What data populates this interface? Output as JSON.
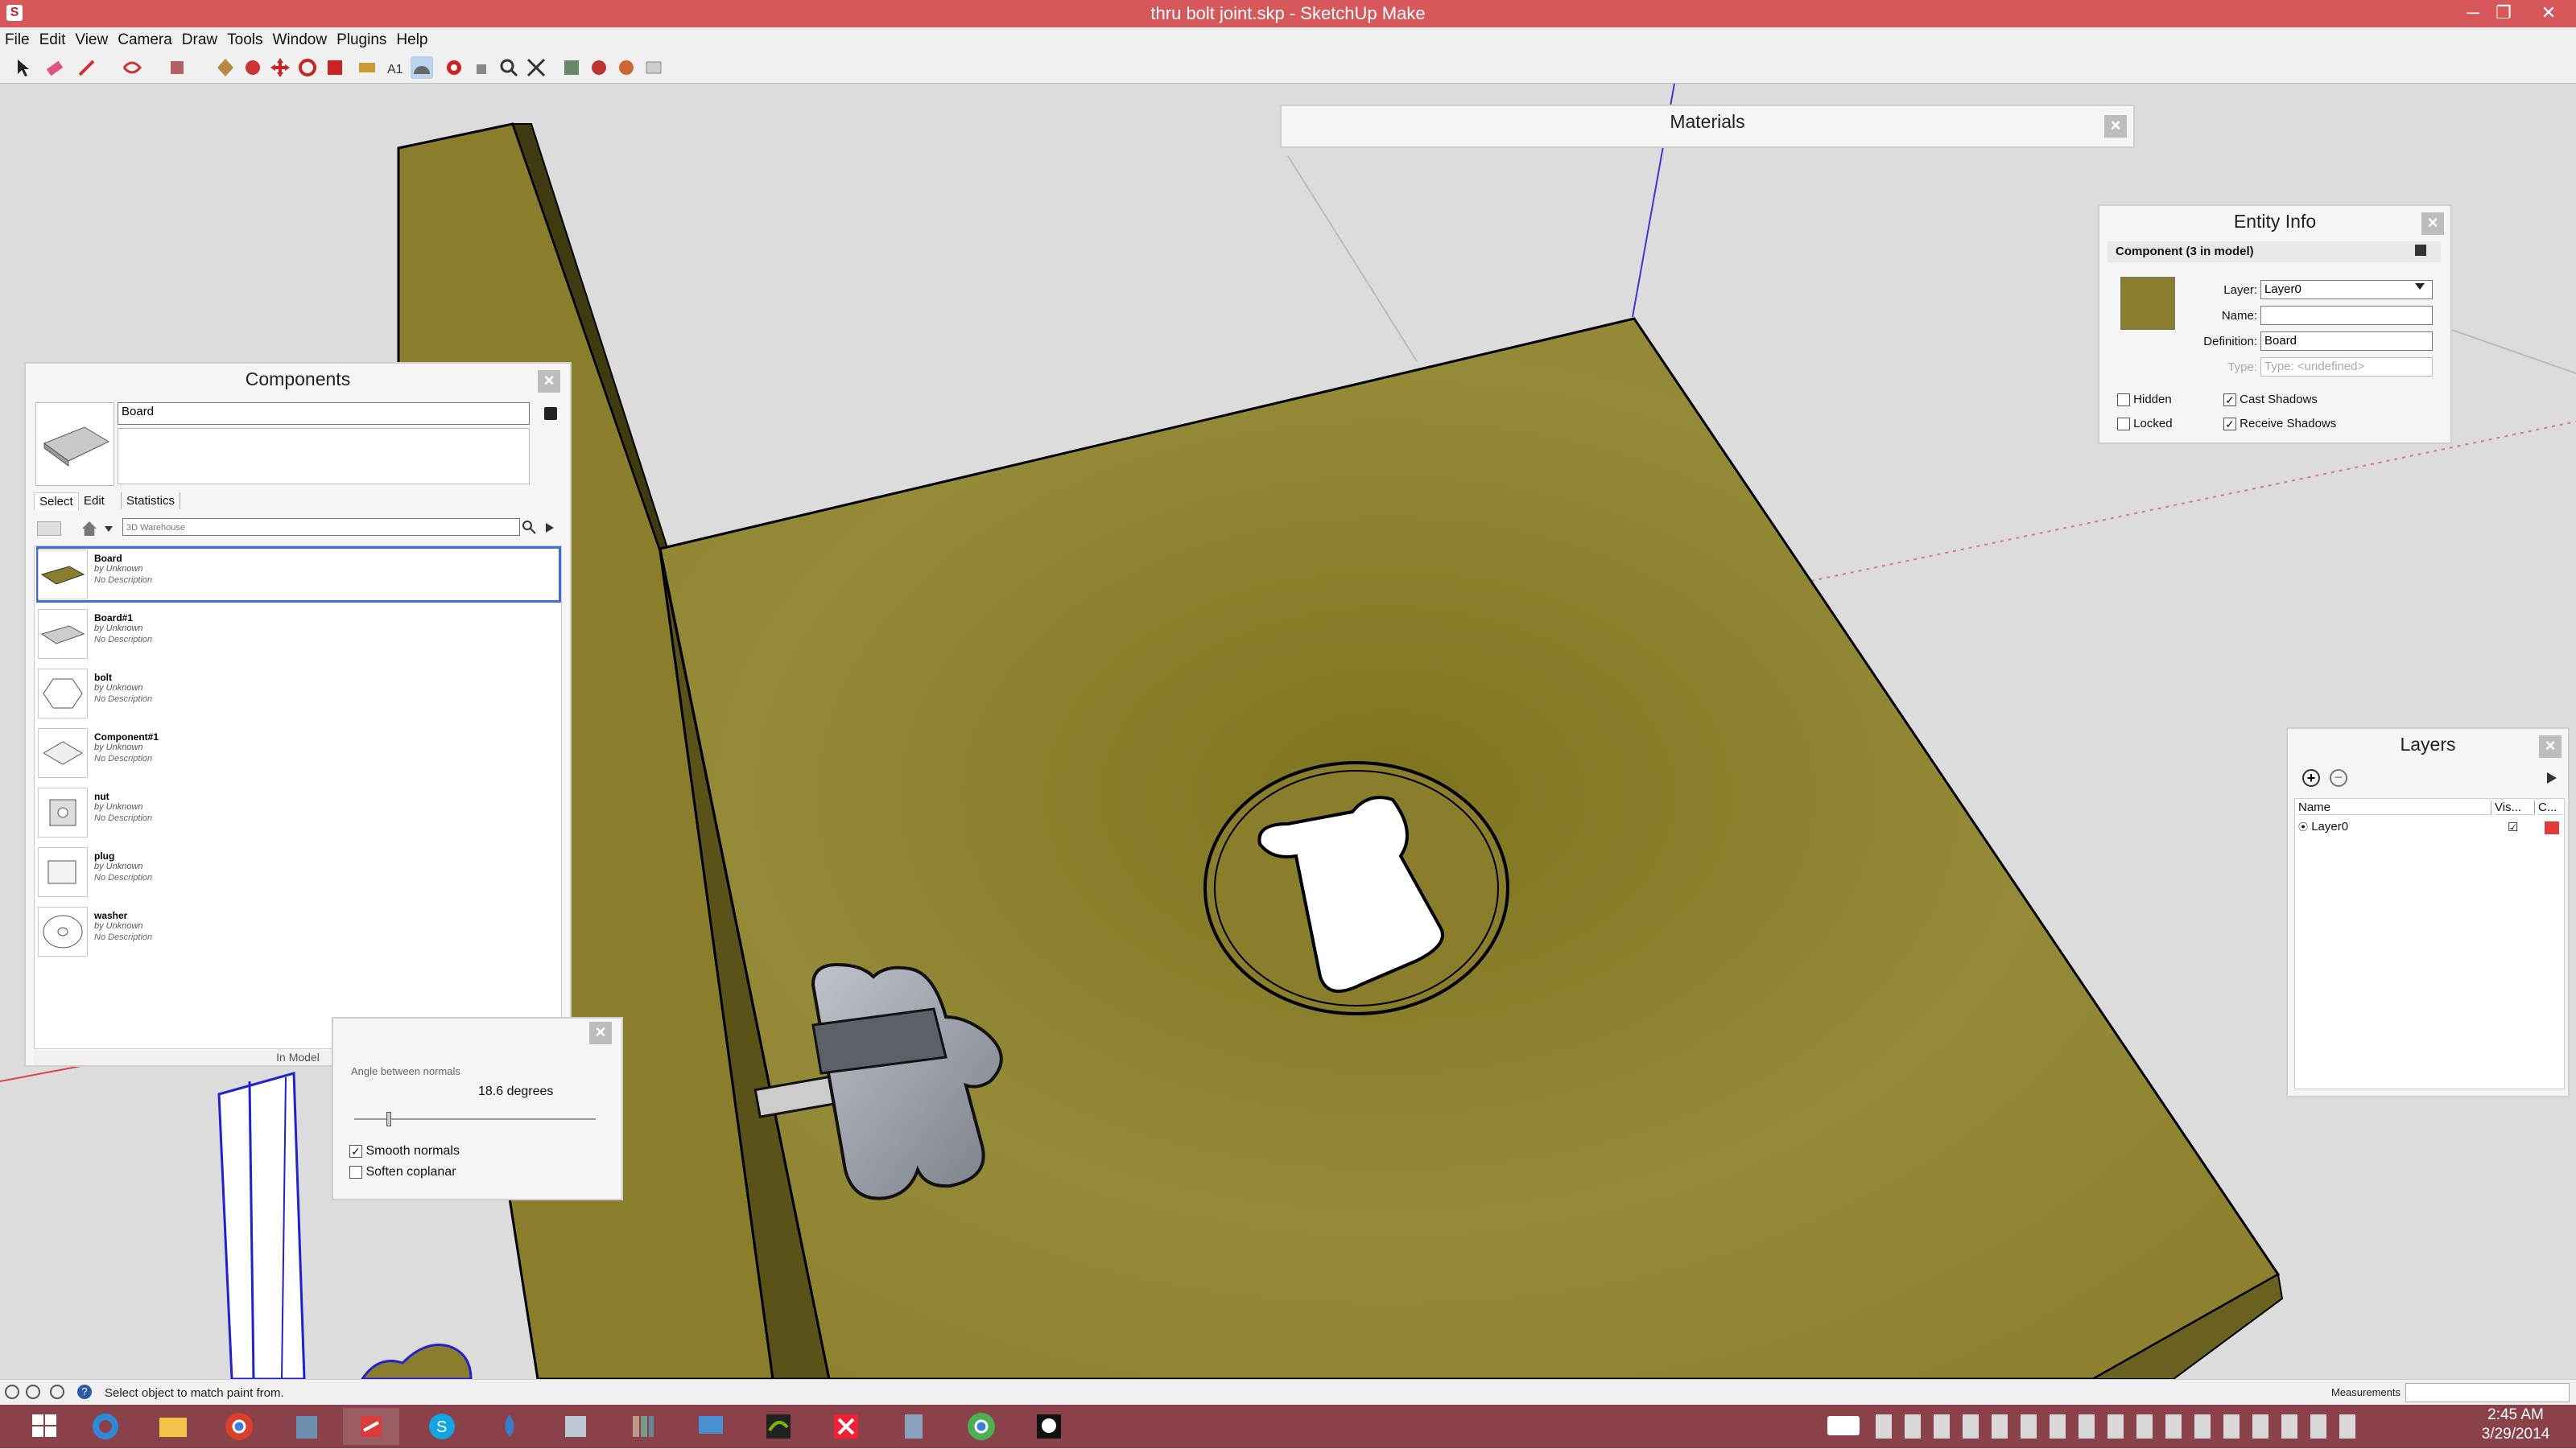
{
  "window": {
    "title": "thru bolt joint.skp - SketchUp Make",
    "minimize": "─",
    "maximize": "❐",
    "close": "✕"
  },
  "menu": [
    "File",
    "Edit",
    "View",
    "Camera",
    "Draw",
    "Tools",
    "Window",
    "Plugins",
    "Help"
  ],
  "toolbar_icons": [
    "select-icon",
    "eraser-icon",
    "pencil-icon",
    "shape-icon",
    "paint-bucket-icon",
    "push-pull-icon",
    "follow-me-icon",
    "move-icon",
    "rotate-icon",
    "scale-icon",
    "tape-measure-icon",
    "text-icon",
    "protractor-icon",
    "dimension-icon",
    "orbit-icon",
    "pan-icon",
    "zoom-icon",
    "zoom-extents-icon",
    "warehouse-icon",
    "extension-icon",
    "share-icon",
    "model-info-icon"
  ],
  "materials": {
    "title": "Materials"
  },
  "entity_info": {
    "title": "Entity Info",
    "header": "Component (3 in model)",
    "layer_label": "Layer:",
    "layer_value": "Layer0",
    "name_label": "Name:",
    "name_value": "",
    "definition_label": "Definition:",
    "definition_value": "Board",
    "type_label": "Type:",
    "type_value": "Type: <undefined>",
    "hidden": "Hidden",
    "locked": "Locked",
    "cast_shadows": "Cast Shadows",
    "receive_shadows": "Receive Shadows"
  },
  "components": {
    "title": "Components",
    "name_value": "Board",
    "tabs": [
      "Select",
      "Edit",
      "Statistics"
    ],
    "search_placeholder": "3D Warehouse",
    "footer": "In Model",
    "items": [
      {
        "name": "Board",
        "by": "by Unknown",
        "desc": "No Description"
      },
      {
        "name": "Board#1",
        "by": "by Unknown",
        "desc": "No Description"
      },
      {
        "name": "bolt",
        "by": "by Unknown",
        "desc": "No Description"
      },
      {
        "name": "Component#1",
        "by": "by Unknown",
        "desc": "No Description"
      },
      {
        "name": "nut",
        "by": "by Unknown",
        "desc": "No Description"
      },
      {
        "name": "plug",
        "by": "by Unknown",
        "desc": "No Description"
      },
      {
        "name": "washer",
        "by": "by Unknown",
        "desc": "No Description"
      }
    ]
  },
  "soften": {
    "angle_label": "Angle between normals",
    "angle_value": "18.6  degrees",
    "smooth_normals": "Smooth normals",
    "soften_coplanar": "Soften coplanar"
  },
  "layers": {
    "title": "Layers",
    "col_name": "Name",
    "col_visible": "Vis...",
    "col_color": "C...",
    "rows": [
      {
        "name": "Layer0",
        "visible": "☑",
        "color": "#e23b3b"
      }
    ]
  },
  "status": {
    "message": "Select object to match paint from.",
    "measurements": "Measurements"
  },
  "taskbar": {
    "time": "2:45 AM",
    "date": "3/29/2014"
  },
  "colors": {
    "titlebar": "#d6585b",
    "wood": "#8f8230",
    "taskbar": "#8a4149"
  }
}
